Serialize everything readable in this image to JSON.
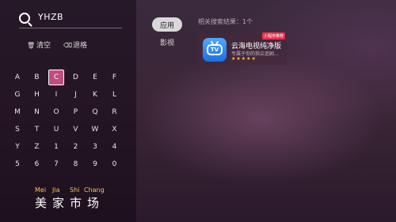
{
  "search": {
    "query": "YHZB"
  },
  "actions": {
    "clear_label": "清空",
    "backspace_label": "退格"
  },
  "keyboard": {
    "rows": [
      [
        "A",
        "B",
        "C",
        "D",
        "E",
        "F"
      ],
      [
        "G",
        "H",
        "I",
        "J",
        "K",
        "L"
      ],
      [
        "M",
        "N",
        "O",
        "P",
        "Q",
        "R"
      ],
      [
        "S",
        "T",
        "U",
        "V",
        "W",
        "X"
      ],
      [
        "Y",
        "Z",
        "1",
        "2",
        "3",
        "4"
      ],
      [
        "5",
        "6",
        "7",
        "8",
        "9",
        "0"
      ]
    ],
    "selected": "C"
  },
  "suggestion": {
    "pinyin": [
      "Mei",
      "Jia",
      "Shi",
      "Chang"
    ],
    "hanzi": [
      "美",
      "家",
      "市",
      "场"
    ]
  },
  "tabs": [
    {
      "label": "应用",
      "active": true
    },
    {
      "label": "影视",
      "active": false
    }
  ],
  "results": {
    "title": "相关搜索结果：1个",
    "items": [
      {
        "name": "云海电视纯净版",
        "description": "专属于你的指尖追剧...",
        "stars": "★★★★★",
        "badge": "小程序推荐",
        "icon": "tv-icon",
        "icon_text": "TV"
      }
    ]
  },
  "colors": {
    "selected_key": "#c04d7f",
    "pinyin": "#f1c45b",
    "star": "#f2c23f",
    "app_icon": "#2a86f2"
  }
}
